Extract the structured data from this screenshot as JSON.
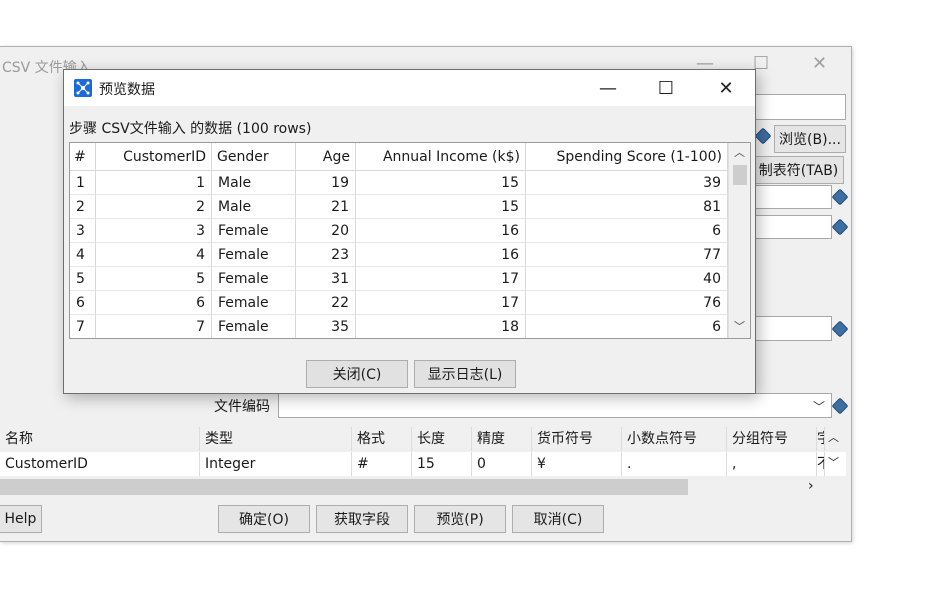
{
  "background_window": {
    "title": "CSV 文件输入",
    "browse_button": "浏览(B)...",
    "tab_button": "制表符(TAB)",
    "file_encoding_label": "文件编码",
    "fields_table": {
      "columns": [
        "名称",
        "类型",
        "格式",
        "长度",
        "精度",
        "货币符号",
        "小数点符号",
        "分组符号",
        "字"
      ],
      "rows": [
        [
          "CustomerID",
          "Integer",
          "#",
          "15",
          "0",
          "¥",
          ".",
          ",",
          "不"
        ]
      ]
    },
    "buttons": {
      "help": "Help",
      "ok": "确定(O)",
      "get_fields": "获取字段",
      "preview": "预览(P)",
      "cancel": "取消(C)"
    }
  },
  "preview_dialog": {
    "title": "预览数据",
    "step_label": "步骤 CSV文件输入 的数据  (100 rows)",
    "table": {
      "columns": [
        "#",
        "CustomerID",
        "Gender",
        "Age",
        "Annual Income (k$)",
        "Spending Score (1-100)"
      ],
      "rows": [
        [
          "1",
          "1",
          "Male",
          "19",
          "15",
          "39"
        ],
        [
          "2",
          "2",
          "Male",
          "21",
          "15",
          "81"
        ],
        [
          "3",
          "3",
          "Female",
          "20",
          "16",
          "6"
        ],
        [
          "4",
          "4",
          "Female",
          "23",
          "16",
          "77"
        ],
        [
          "5",
          "5",
          "Female",
          "31",
          "17",
          "40"
        ],
        [
          "6",
          "6",
          "Female",
          "22",
          "17",
          "76"
        ],
        [
          "7",
          "7",
          "Female",
          "35",
          "18",
          "6"
        ]
      ]
    },
    "buttons": {
      "close": "关闭(C)",
      "show_log": "显示日志(L)"
    }
  },
  "icons": {
    "minimize": "minimize-icon",
    "maximize": "maximize-icon",
    "close": "close-icon",
    "variable": "variable-diamond-icon",
    "app": "kettle-app-icon"
  },
  "colors": {
    "accent": "#1b6ad8",
    "variable_icon": "#3d6fa3"
  }
}
